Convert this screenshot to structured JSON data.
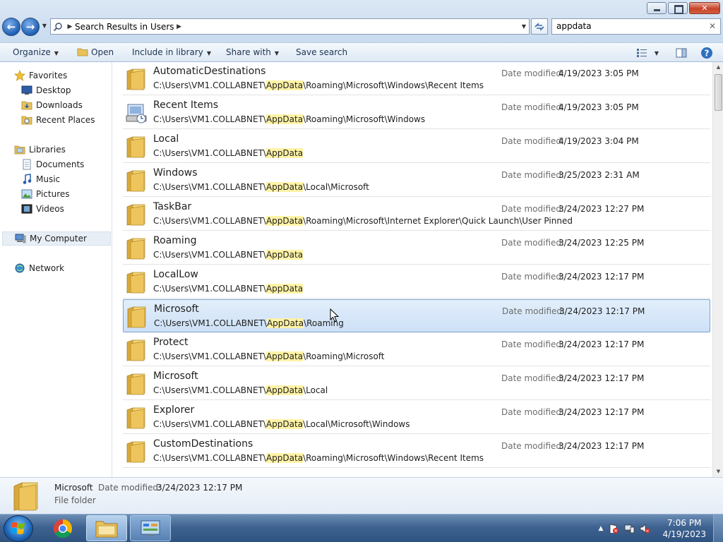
{
  "window": {
    "controls": {
      "minimize": "minimize-icon",
      "restore": "restore-icon",
      "close": "close-icon"
    }
  },
  "address_bar": {
    "location": "Search Results in Users",
    "search_value": "appdata"
  },
  "toolbar": {
    "organize": "Organize",
    "open": "Open",
    "include_in_library": "Include in library",
    "share_with": "Share with",
    "save_search": "Save search"
  },
  "sidebar": {
    "favorites_header": "Favorites",
    "favorites": [
      "Desktop",
      "Downloads",
      "Recent Places"
    ],
    "libraries_header": "Libraries",
    "libraries": [
      "Documents",
      "Music",
      "Pictures",
      "Videos"
    ],
    "computer": "My Computer",
    "network": "Network"
  },
  "results": {
    "date_label": "Date modified:",
    "highlight_term": "AppData",
    "items": [
      {
        "name": "AutomaticDestinations",
        "path_prefix": "C:\\Users\\VM1.COLLABNET\\",
        "path_match": "AppData",
        "path_suffix": "\\Roaming\\Microsoft\\Windows\\Recent Items",
        "date": "4/19/2023 3:05 PM",
        "icon": "folder-icon"
      },
      {
        "name": "Recent Items",
        "path_prefix": "C:\\Users\\VM1.COLLABNET\\",
        "path_match": "AppData",
        "path_suffix": "\\Roaming\\Microsoft\\Windows",
        "date": "4/19/2023 3:05 PM",
        "icon": "recent-items-icon"
      },
      {
        "name": "Local",
        "path_prefix": "C:\\Users\\VM1.COLLABNET\\",
        "path_match": "AppData",
        "path_suffix": "",
        "date": "4/19/2023 3:04 PM",
        "icon": "folder-icon"
      },
      {
        "name": "Windows",
        "path_prefix": "C:\\Users\\VM1.COLLABNET\\",
        "path_match": "AppData",
        "path_suffix": "\\Local\\Microsoft",
        "date": "3/25/2023 2:31 AM",
        "icon": "folder-icon"
      },
      {
        "name": "TaskBar",
        "path_prefix": "C:\\Users\\VM1.COLLABNET\\",
        "path_match": "AppData",
        "path_suffix": "\\Roaming\\Microsoft\\Internet Explorer\\Quick Launch\\User Pinned",
        "date": "3/24/2023 12:27 PM",
        "icon": "folder-icon"
      },
      {
        "name": "Roaming",
        "path_prefix": "C:\\Users\\VM1.COLLABNET\\",
        "path_match": "AppData",
        "path_suffix": "",
        "date": "3/24/2023 12:25 PM",
        "icon": "folder-icon"
      },
      {
        "name": "LocalLow",
        "path_prefix": "C:\\Users\\VM1.COLLABNET\\",
        "path_match": "AppData",
        "path_suffix": "",
        "date": "3/24/2023 12:17 PM",
        "icon": "folder-icon"
      },
      {
        "name": "Microsoft",
        "path_prefix": "C:\\Users\\VM1.COLLABNET\\",
        "path_match": "AppData",
        "path_suffix": "\\Roaming",
        "date": "3/24/2023 12:17 PM",
        "icon": "folder-icon",
        "selected": true
      },
      {
        "name": "Protect",
        "path_prefix": "C:\\Users\\VM1.COLLABNET\\",
        "path_match": "AppData",
        "path_suffix": "\\Roaming\\Microsoft",
        "date": "3/24/2023 12:17 PM",
        "icon": "folder-icon"
      },
      {
        "name": "Microsoft",
        "path_prefix": "C:\\Users\\VM1.COLLABNET\\",
        "path_match": "AppData",
        "path_suffix": "\\Local",
        "date": "3/24/2023 12:17 PM",
        "icon": "folder-icon"
      },
      {
        "name": "Explorer",
        "path_prefix": "C:\\Users\\VM1.COLLABNET\\",
        "path_match": "AppData",
        "path_suffix": "\\Local\\Microsoft\\Windows",
        "date": "3/24/2023 12:17 PM",
        "icon": "folder-icon"
      },
      {
        "name": "CustomDestinations",
        "path_prefix": "C:\\Users\\VM1.COLLABNET\\",
        "path_match": "AppData",
        "path_suffix": "\\Roaming\\Microsoft\\Windows\\Recent Items",
        "date": "3/24/2023 12:17 PM",
        "icon": "folder-icon"
      }
    ]
  },
  "details_pane": {
    "name": "Microsoft",
    "date_label": "Date modified:",
    "date": "3/24/2023 12:17 PM",
    "type": "File folder"
  },
  "taskbar": {
    "time": "7:06 PM",
    "date": "4/19/2023"
  },
  "colors": {
    "highlight": "#fff3a6",
    "selection": "#cde1f7",
    "selection_border": "#7da2ce",
    "folder": "#e8c25a"
  }
}
